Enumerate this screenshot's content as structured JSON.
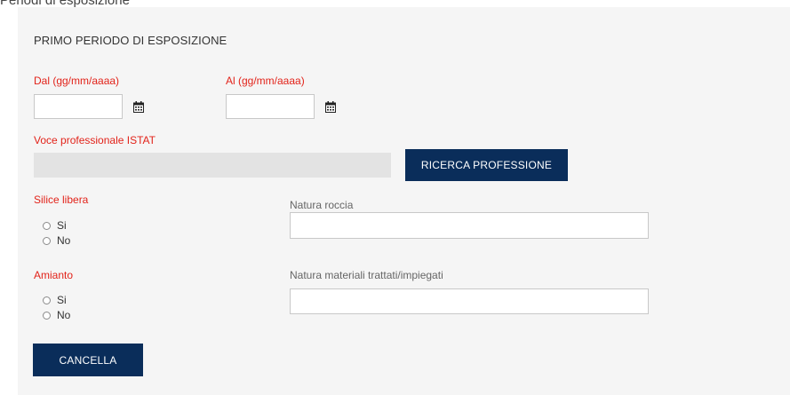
{
  "page": {
    "section_title": "Periodi di esposizione"
  },
  "form": {
    "heading": "PRIMO PERIODO DI ESPOSIZIONE",
    "dal": {
      "label": "Dal (gg/mm/aaaa)",
      "value": "",
      "icon": "calendar-icon"
    },
    "al": {
      "label": "Al (gg/mm/aaaa)",
      "value": "",
      "icon": "calendar-icon"
    },
    "istat": {
      "label": "Voce professionale ISTAT",
      "value": ""
    },
    "ricerca_button": "RICERCA PROFESSIONE",
    "silice": {
      "label": "Silice libera",
      "options": [
        "Si",
        "No"
      ]
    },
    "natura_roccia": {
      "label": "Natura roccia",
      "value": ""
    },
    "amianto": {
      "label": "Amianto",
      "options": [
        "Si",
        "No"
      ]
    },
    "natura_materiali": {
      "label": "Natura materiali trattati/impiegati",
      "value": ""
    },
    "cancella_button": "CANCELLA"
  },
  "colors": {
    "required_label": "#e2231a",
    "button_bg": "#0a2d5a",
    "panel_bg": "#f5f5f5"
  }
}
